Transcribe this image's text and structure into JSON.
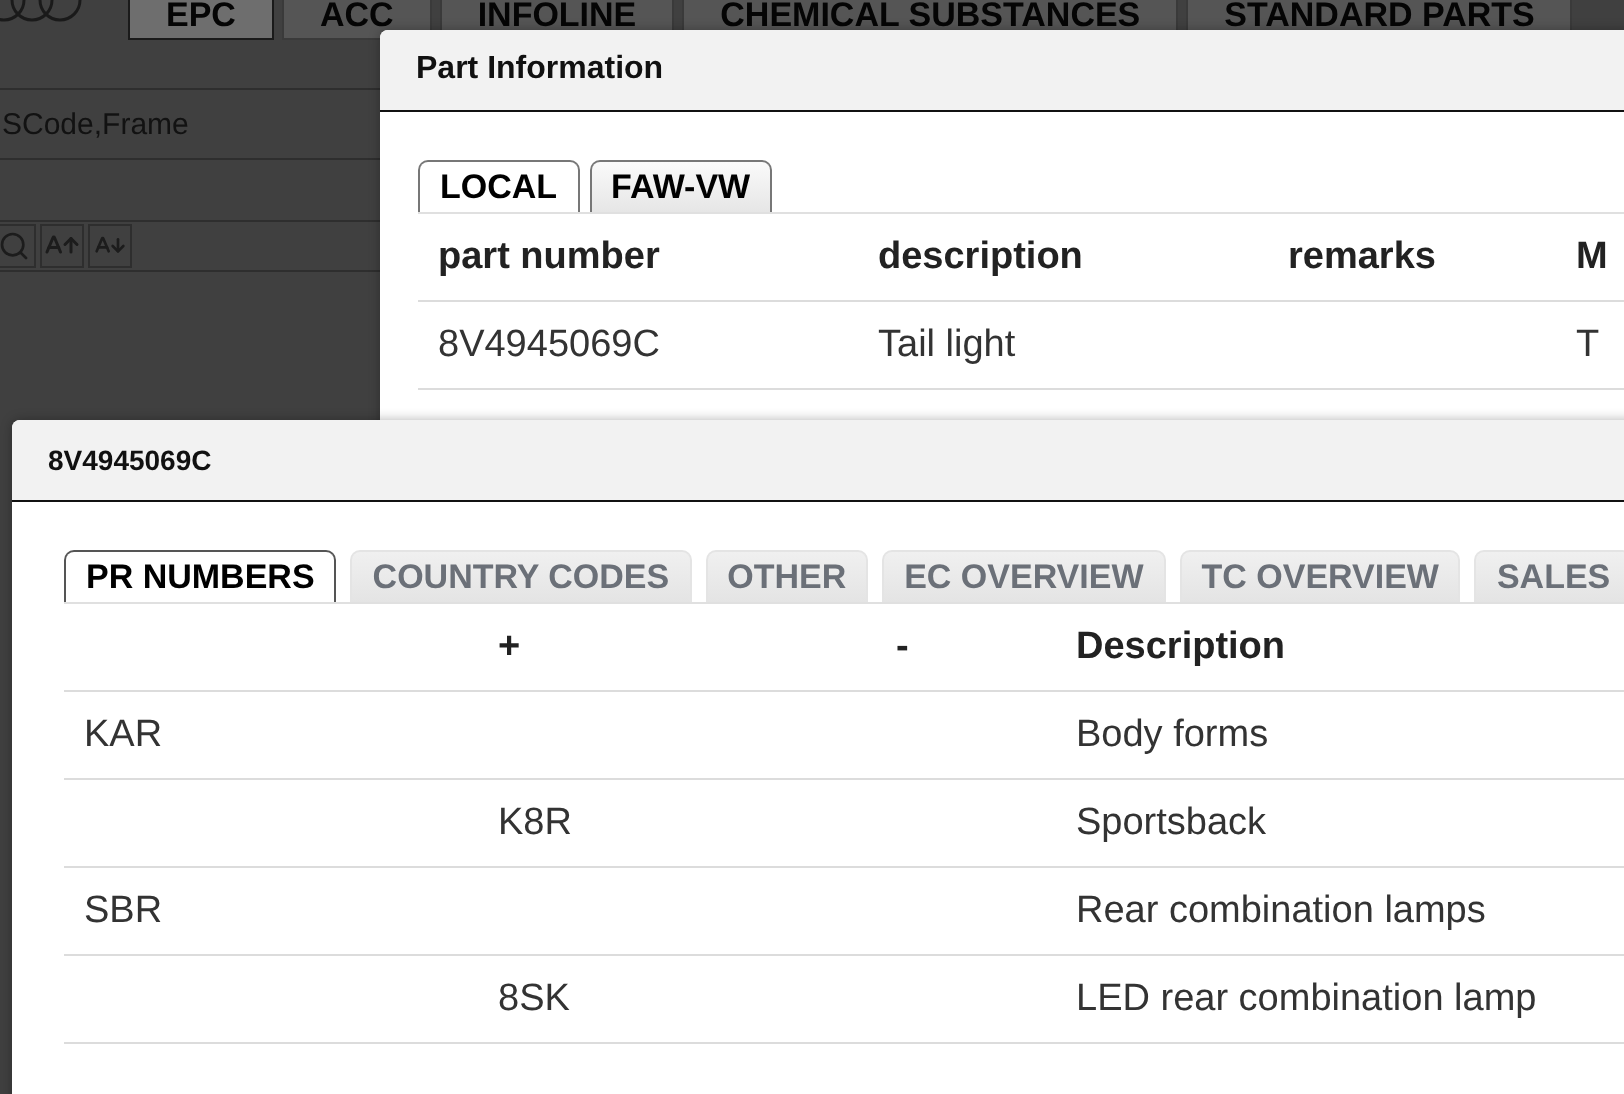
{
  "app": {
    "top_tabs": [
      {
        "label": "EPC",
        "selected": true
      },
      {
        "label": "ACC",
        "selected": false
      },
      {
        "label": "INFOLINE",
        "selected": false
      },
      {
        "label": "CHEMICAL SUBSTANCES",
        "selected": false
      },
      {
        "label": "STANDARD PARTS",
        "selected": false
      }
    ],
    "search": {
      "placeholder": "SCode,Frame"
    }
  },
  "part_information": {
    "title": "Part Information",
    "tabs": [
      {
        "label": "LOCAL",
        "selected": true
      },
      {
        "label": "FAW-VW",
        "selected": false
      }
    ],
    "table": {
      "headers": {
        "part_number": "part number",
        "description": "description",
        "remarks": "remarks",
        "column_4": "M"
      },
      "rows": [
        {
          "part_number": "8V4945069C",
          "description": "Tail light",
          "column_4": "T"
        }
      ]
    }
  },
  "part_dialog": {
    "title": "8V4945069C",
    "tabs": [
      {
        "label": "PR NUMBERS",
        "selected": true
      },
      {
        "label": "COUNTRY CODES",
        "selected": false
      },
      {
        "label": "OTHER",
        "selected": false
      },
      {
        "label": "EC OVERVIEW",
        "selected": false
      },
      {
        "label": "TC OVERVIEW",
        "selected": false
      },
      {
        "label": "SALES",
        "selected": false
      }
    ],
    "table": {
      "headers": {
        "plus": "+",
        "minus": "-",
        "description": "Description"
      },
      "rows": [
        {
          "column_1": "KAR",
          "description": "Body forms"
        },
        {
          "plus": "K8R",
          "description": "Sportsback"
        },
        {
          "column_1": "SBR",
          "description": "Rear combination lamps"
        },
        {
          "plus": "8SK",
          "description": "LED rear combination lamp"
        }
      ]
    }
  }
}
